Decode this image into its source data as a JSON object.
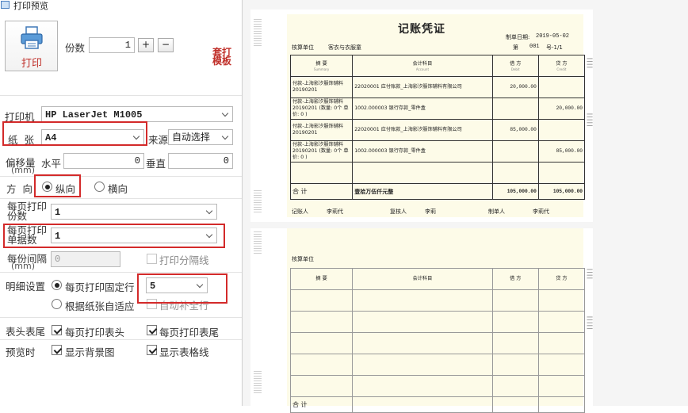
{
  "window": {
    "title": "打印预览"
  },
  "print_button": {
    "label": "打印",
    "icon": "printer-icon"
  },
  "copies": {
    "label": "份数",
    "value": "1",
    "plus": "+",
    "minus": "−"
  },
  "template_link": {
    "label": "套打模板"
  },
  "printer": {
    "label": "打印机",
    "value": "HP LaserJet M1005"
  },
  "paper": {
    "label": "纸  张",
    "value": "A4"
  },
  "source": {
    "label": "来源",
    "value": "自动选择"
  },
  "offset": {
    "label": "偏移量",
    "unit": "(mm)",
    "h_label": "水平",
    "h_value": "0",
    "v_label": "垂直",
    "v_value": "0"
  },
  "orientation": {
    "label": "方  向",
    "portrait": "纵向",
    "landscape": "横向",
    "selected": "portrait"
  },
  "copies_per_page": {
    "label": "每页打印份数",
    "value": "1"
  },
  "vouchers_per_page": {
    "label": "每页打印单据数",
    "value": "1"
  },
  "copy_gap": {
    "label": "每份间隔",
    "unit": "(mm)",
    "value": "0",
    "separator_label": "打印分隔线"
  },
  "detail": {
    "label": "明细设置",
    "fixed_rows_label": "每页打印固定行",
    "fixed_rows_value": "5",
    "auto_fit_label": "根据纸张自适应",
    "auto_fill_label": "自动补全行"
  },
  "header_footer": {
    "label": "表头表尾",
    "print_header": "每页打印表头",
    "print_footer": "每页打印表尾"
  },
  "preview_opts": {
    "label": "预览时",
    "show_bg": "显示背景图",
    "show_grid": "显示表格线"
  },
  "colors": {
    "highlight": "#d32a2a",
    "link": "#c0302a",
    "voucher_bg": "#fdfbe8"
  },
  "voucher": {
    "title": "记账凭证",
    "date_label": "制单日期:",
    "date": "2019-05-02",
    "unit_label": "核算单位",
    "unit_name": "客衣与衣服童",
    "number_label": "第",
    "number": "001",
    "number_suffix": "号-1/1",
    "columns": [
      {
        "label": "摘 要",
        "sub": "Summary"
      },
      {
        "label": "会计科目",
        "sub": "Account"
      },
      {
        "label": "借 方",
        "sub": "Debit"
      },
      {
        "label": "贷 方",
        "sub": "Credit"
      }
    ],
    "rows": [
      {
        "summary": "付款-上海影汐服饰辅料 20190201",
        "account": "22020001 应付账款_上海影汐服饰辅料有限公司",
        "debit": "20,000.00",
        "credit": ""
      },
      {
        "summary": "付款-上海影汐服饰辅料 20190201 (数量: 0个 单价: 0 )",
        "account": "1002.000003 银行存款_零件盒",
        "debit": "",
        "credit": "20,000.00"
      },
      {
        "summary": "付款-上海影汐服饰辅料 20190201",
        "account": "22020001 应付账款_上海影汐服饰辅料有限公司",
        "debit": "85,000.00",
        "credit": ""
      },
      {
        "summary": "付款-上海影汐服饰辅料 20190201 (数量: 0个 单价: 0 )",
        "account": "1002.000003 银行存款_零件盒",
        "debit": "",
        "credit": "85,000.00"
      },
      {
        "summary": "",
        "account": "",
        "debit": "",
        "credit": ""
      }
    ],
    "total_label": "合 计",
    "total_text": "壹拾万伍仟元整",
    "total_debit": "105,000.00",
    "total_credit": "105,000.00",
    "bookkeeper_label": "记账人",
    "bookkeeper": "李莉代",
    "reviewer_label": "复核人",
    "reviewer": "李莉",
    "maker_label": "制单人",
    "maker": "李莉代"
  },
  "voucher2": {
    "unit_label": "核算单位",
    "columns": [
      "摘 要",
      "会计科目",
      "借 方",
      "贷 方"
    ],
    "total_label": "合 计"
  }
}
